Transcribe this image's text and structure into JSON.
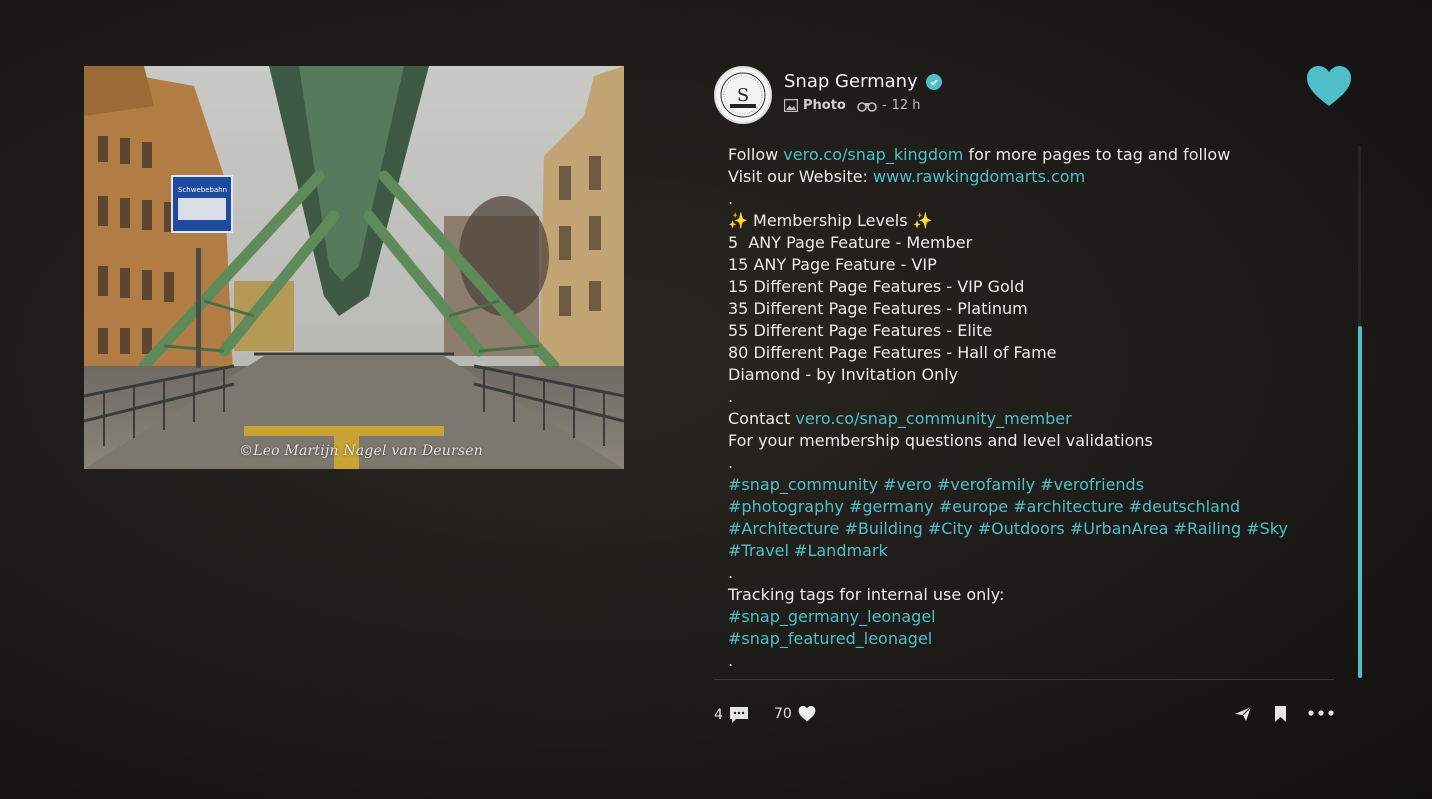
{
  "post": {
    "photo_watermark": "©Leo Martijn Nagel van Deursen",
    "sign_text": "Schwebebahn",
    "author": "Snap Germany",
    "post_type": "Photo",
    "time_ago": "12 h",
    "separator": "-",
    "avatar_letter": "S",
    "caption_lines": [
      [
        {
          "t": "Follow "
        },
        {
          "t": "vero.co/snap_kingdom",
          "link": true
        },
        {
          "t": " for more pages to tag and follow"
        }
      ],
      [
        {
          "t": "Visit our Website: "
        },
        {
          "t": "www.rawkingdomarts.com",
          "link": true
        }
      ],
      [
        {
          "t": "."
        }
      ],
      [
        {
          "t": "✨ Membership Levels ✨"
        }
      ],
      [
        {
          "t": "5  ANY Page Feature - Member"
        }
      ],
      [
        {
          "t": "15 ANY Page Feature - VIP"
        }
      ],
      [
        {
          "t": "15 Different Page Features - VIP Gold"
        }
      ],
      [
        {
          "t": "35 Different Page Features - Platinum"
        }
      ],
      [
        {
          "t": "55 Different Page Features - Elite"
        }
      ],
      [
        {
          "t": "80 Different Page Features - Hall of Fame"
        }
      ],
      [
        {
          "t": "Diamond - by Invitation Only"
        }
      ],
      [
        {
          "t": "."
        }
      ],
      [
        {
          "t": "Contact "
        },
        {
          "t": "vero.co/snap_community_member",
          "link": true
        }
      ],
      [
        {
          "t": "For your membership questions and level validations"
        }
      ],
      [
        {
          "t": "."
        }
      ],
      [
        {
          "t": "#snap_community #vero #verofamily #verofriends",
          "link": true
        }
      ],
      [
        {
          "t": "#photography #germany #europe #architecture #deutschland",
          "link": true
        }
      ],
      [
        {
          "t": "#Architecture #Building #City #Outdoors #UrbanArea #Railing #Sky",
          "link": true
        }
      ],
      [
        {
          "t": "#Travel #Landmark",
          "link": true
        }
      ],
      [
        {
          "t": "."
        }
      ],
      [
        {
          "t": "Tracking tags for internal use only:"
        }
      ],
      [
        {
          "t": "#snap_germany_leonagel",
          "link": true
        }
      ],
      [
        {
          "t": "#snap_featured_leonagel",
          "link": true
        }
      ],
      [
        {
          "t": "."
        }
      ]
    ],
    "comments_count": "4",
    "likes_count": "70"
  },
  "icons": {
    "like_big": "heart-icon",
    "comment": "comment-icon",
    "like": "heart-icon",
    "share": "send-icon",
    "bookmark": "bookmark-icon",
    "more": "more-icon",
    "photo_type": "image-icon",
    "views": "binoculars-icon",
    "verified": "verified-check-icon"
  },
  "colors": {
    "accent": "#4fbfc7",
    "background": "#1d1b18",
    "text": "#ececec"
  }
}
